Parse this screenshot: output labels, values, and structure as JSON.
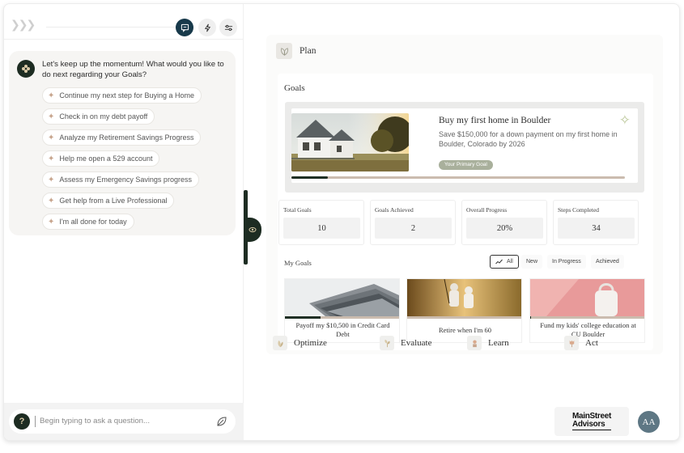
{
  "left_panel": {
    "bot_message": "Let's keep up the momentum! What would you like to do next regarding your Goals?",
    "suggestions": [
      "Continue my next step for Buying a Home",
      "Check in on my debt payoff",
      "Analyze my Retirement Savings Progress",
      "Help me open a 529 account",
      "Assess my Emergency Savings progress",
      "Get help from a Live Professional",
      "I'm all done for today"
    ],
    "ask_placeholder": "Begin typing to ask a question...",
    "help_glyph": "?"
  },
  "plan": {
    "title": "Plan",
    "goals_title": "Goals",
    "primary_goal": {
      "title": "Buy my first home in Boulder",
      "description": "Save $150,000 for a down payment on my first home in Boulder, Colorado by 2026",
      "badge": "Your Primary Goal",
      "progress": 0.11
    },
    "stats": [
      {
        "label": "Total Goals",
        "value": "10"
      },
      {
        "label": "Goals Achieved",
        "value": "2"
      },
      {
        "label": "Overall Progress",
        "value": "20%"
      },
      {
        "label": "Steps Completed",
        "value": "34"
      }
    ],
    "my_goals_label": "My Goals",
    "filters": [
      "All",
      "New",
      "In Progress",
      "Achieved"
    ],
    "active_filter": "All",
    "goal_cards": [
      {
        "title": "Payoff my $10,500 in Credit Card Debt",
        "progress": 0.31
      },
      {
        "title": "Retire when I'm 60",
        "progress": 0.0
      },
      {
        "title": "Fund my kids' college education at CU Boulder",
        "progress": 0.01
      }
    ]
  },
  "steps": [
    "Optimize",
    "Evaluate",
    "Learn",
    "Act"
  ],
  "brand": {
    "line1": "MainStreet",
    "line2": "Advisors"
  },
  "user": {
    "initials": "AA"
  },
  "colors": {
    "dark_green": "#1d2c22",
    "navy": "#17394a",
    "progress_track": "#cbbcaf",
    "badge": "#a9b09c",
    "avatar": "#5e7784"
  }
}
